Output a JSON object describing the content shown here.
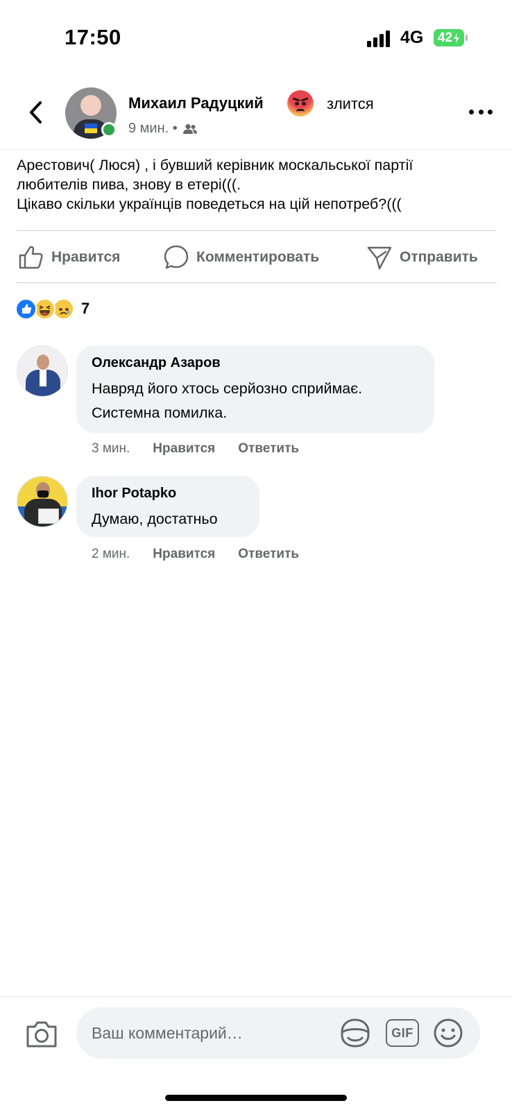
{
  "status_bar": {
    "time": "17:50",
    "network": "4G",
    "battery": "42"
  },
  "post": {
    "author_name": "Михаил Радуцкий",
    "feeling": "злится",
    "timestamp": "9 мин. •",
    "audience_icon": "friends-icon",
    "feeling_icon": "angry-emoji-icon",
    "body_lines": [
      "Арестович( Люся) , і бувший керівник москальської партії",
      "любителів пива, знову в етері(((.",
      "Цікаво скільки українців поведеться на цій непотреб?((("
    ]
  },
  "actions": {
    "like": "Нравится",
    "comment": "Комментировать",
    "share": "Отправить"
  },
  "reactions": {
    "types": [
      "like",
      "haha",
      "sad"
    ],
    "count": "7"
  },
  "comments": [
    {
      "author": "Олександр Азаров",
      "lines": [
        "Навряд його хтось серйозно сприймає.",
        "Системна помилка."
      ],
      "time": "3 мин.",
      "like_label": "Нравится",
      "reply_label": "Ответить"
    },
    {
      "author": "Ihor Potapko",
      "lines": [
        "Думаю, достатньо"
      ],
      "time": "2 мин.",
      "like_label": "Нравится",
      "reply_label": "Ответить"
    }
  ],
  "composer": {
    "placeholder": "Ваш комментарий…",
    "gif_label": "GIF"
  },
  "colors": {
    "secondary_text": "#65676b",
    "bubble_bg": "#f0f2f5",
    "online": "#31a24c",
    "like_blue": "#1877f2",
    "battery_green": "#4cd964"
  }
}
